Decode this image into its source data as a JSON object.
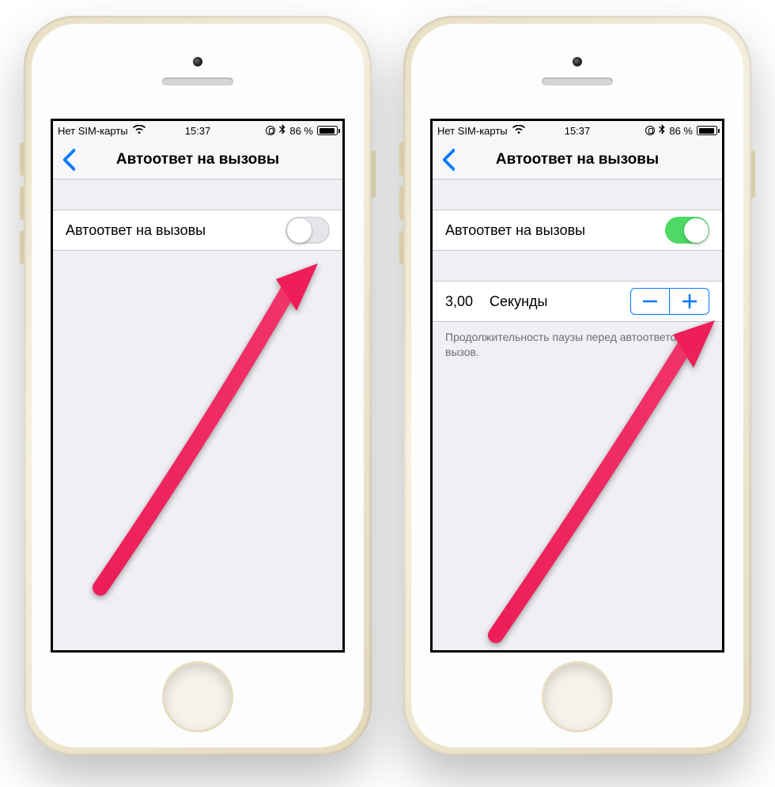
{
  "statusbar": {
    "carrier": "Нет SIM-карты",
    "time": "15:37",
    "battery_pct": "86 %"
  },
  "nav": {
    "title": "Автоответ на вызовы"
  },
  "left_phone": {
    "toggle_label": "Автоответ на вызовы",
    "toggle_on": false
  },
  "right_phone": {
    "toggle_label": "Автоответ на вызовы",
    "toggle_on": true,
    "seconds_value": "3,00",
    "seconds_label": "Секунды",
    "footer_note": "Продолжительность паузы перед автоответом на вызов."
  },
  "annotation": {
    "arrow_color": "#ed1e58"
  }
}
